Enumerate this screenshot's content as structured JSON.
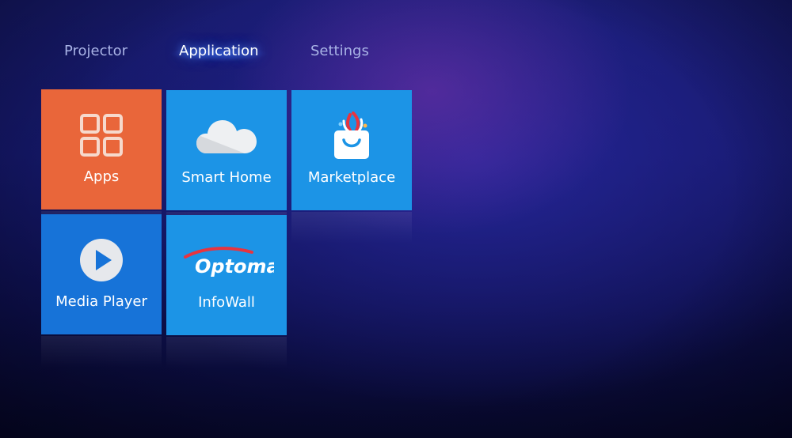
{
  "tabs": [
    {
      "label": "Projector",
      "active": false
    },
    {
      "label": "Application",
      "active": true
    },
    {
      "label": "Settings",
      "active": false
    }
  ],
  "tiles": [
    {
      "label": "Apps",
      "icon": "apps-grid-icon",
      "color": "#e9663a"
    },
    {
      "label": "Smart Home",
      "icon": "cloud-icon",
      "color": "#1c94e6"
    },
    {
      "label": "Marketplace",
      "icon": "shopping-bag-icon",
      "color": "#1c94e6"
    },
    {
      "label": "Media Player",
      "icon": "play-icon",
      "color": "#1773d8"
    },
    {
      "label": "InfoWall",
      "icon": "optoma-logo",
      "logo_text": "Optoma",
      "color": "#1c94e6"
    }
  ],
  "colors": {
    "accent_orange": "#e9663a",
    "tile_blue": "#1c94e6",
    "tile_dark_blue": "#1773d8",
    "tab_inactive": "#a9b3e6",
    "tab_active": "#ffffff",
    "logo_red": "#e8343f"
  }
}
